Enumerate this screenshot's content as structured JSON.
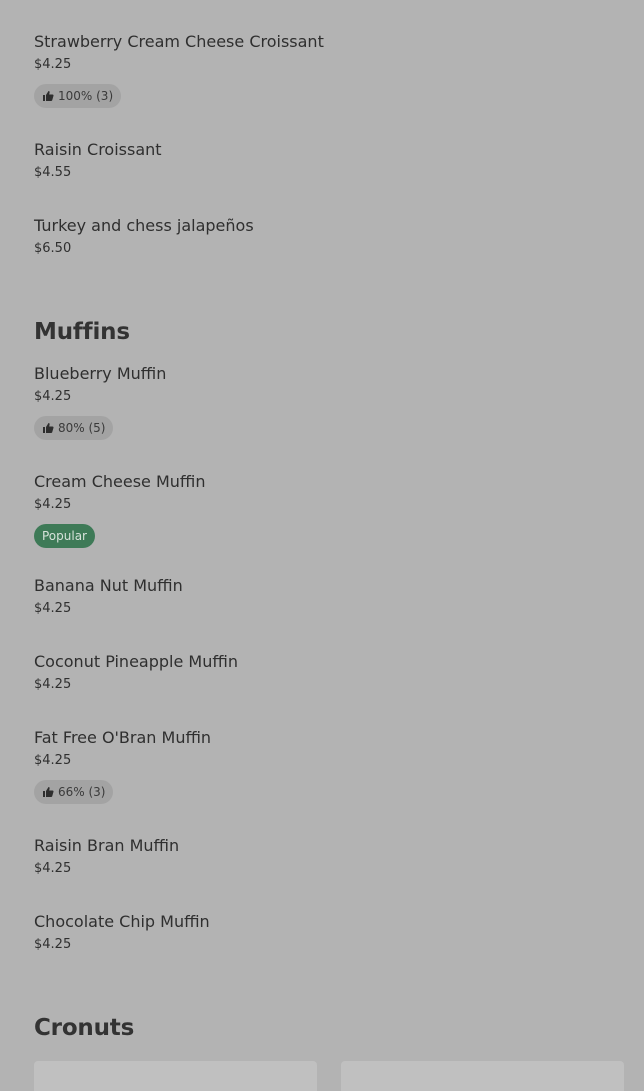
{
  "sections": {
    "croissants": {
      "items": [
        {
          "name": "Strawberry Cream Cheese Croissant",
          "price": "$4.25",
          "rating": "100% (3)"
        },
        {
          "name": "Raisin Croissant",
          "price": "$4.55"
        },
        {
          "name": "Turkey and chess jalapeños",
          "price": "$6.50"
        }
      ]
    },
    "muffins": {
      "heading": "Muffins",
      "items": [
        {
          "name": "Blueberry Muffin",
          "price": "$4.25",
          "rating": "80% (5)"
        },
        {
          "name": "Cream Cheese Muffin",
          "price": "$4.25",
          "badge": "Popular"
        },
        {
          "name": "Banana Nut Muffin",
          "price": "$4.25"
        },
        {
          "name": "Coconut Pineapple Muffin",
          "price": "$4.25"
        },
        {
          "name": "Fat Free O'Bran Muffin",
          "price": "$4.25",
          "rating": "66% (3)"
        },
        {
          "name": "Raisin Bran Muffin",
          "price": "$4.25"
        },
        {
          "name": "Chocolate Chip Muffin",
          "price": "$4.25"
        }
      ]
    },
    "cronuts": {
      "heading": "Cronuts"
    }
  },
  "icons": {
    "rating": "thumbs-up-icon"
  },
  "colors": {
    "background": "#b3b3b3",
    "popular_badge": "#3e7a57",
    "rating_badge": "#a3a3a3"
  }
}
